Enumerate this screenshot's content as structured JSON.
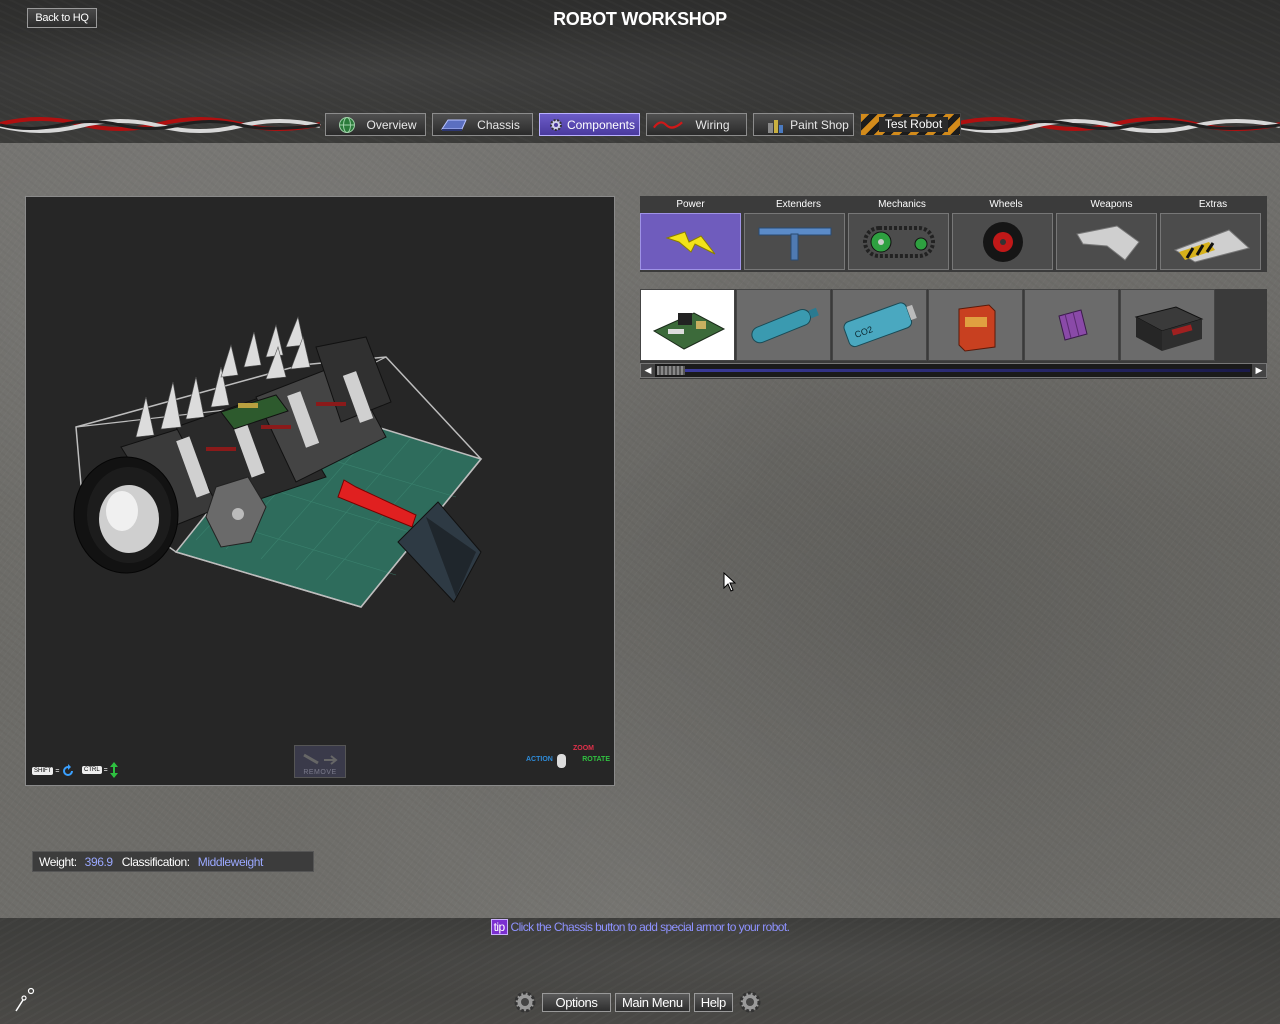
{
  "header": {
    "back_label": "Back to HQ",
    "title": "ROBOT WORKSHOP"
  },
  "nav_tabs": [
    {
      "label": "Overview",
      "icon": "globe-icon",
      "active": false
    },
    {
      "label": "Chassis",
      "icon": "chassis-icon",
      "active": false
    },
    {
      "label": "Components",
      "icon": "gear-icon",
      "active": true
    },
    {
      "label": "Wiring",
      "icon": "wire-icon",
      "active": false
    },
    {
      "label": "Paint Shop",
      "icon": "paint-cans-icon",
      "active": false
    },
    {
      "label": "Test Robot",
      "icon": "hazard-stripes",
      "active": false
    }
  ],
  "viewport": {
    "remove_label": "REMOVE",
    "shift_key": "SHIFT",
    "ctrl_key": "CTRL",
    "mouse_zoom": "ZOOM",
    "mouse_action": "ACTION",
    "mouse_rotate": "ROTATE"
  },
  "categories": [
    {
      "label": "Power",
      "icon": "lightning-icon",
      "active": true
    },
    {
      "label": "Extenders",
      "icon": "extender-bar-icon",
      "active": false
    },
    {
      "label": "Mechanics",
      "icon": "chain-drive-icon",
      "active": false
    },
    {
      "label": "Wheels",
      "icon": "wheel-icon",
      "active": false
    },
    {
      "label": "Weapons",
      "icon": "blade-icon",
      "active": false
    },
    {
      "label": "Extras",
      "icon": "wedge-icon",
      "active": false
    }
  ],
  "parts": [
    {
      "icon": "circuit-board-icon",
      "active": true
    },
    {
      "icon": "gas-canister-icon",
      "active": false
    },
    {
      "icon": "co2-tank-icon",
      "label": "CO2",
      "active": false
    },
    {
      "icon": "battery-red-icon",
      "active": false
    },
    {
      "icon": "battery-purple-icon",
      "active": false
    },
    {
      "icon": "battery-box-icon",
      "active": false
    }
  ],
  "stats": {
    "weight_label": "Weight:",
    "weight_value": "396.9",
    "class_label": "Classification:",
    "class_value": "Middleweight"
  },
  "tip": {
    "badge": "tip",
    "text": "Click the Chassis button to add special armor to your robot."
  },
  "footer": {
    "options_label": "Options",
    "main_menu_label": "Main Menu",
    "help_label": "Help"
  },
  "colors": {
    "accent_purple": "#6f5cbd",
    "stat_value": "#9aa8ff",
    "tip_text": "#8e92ff"
  }
}
